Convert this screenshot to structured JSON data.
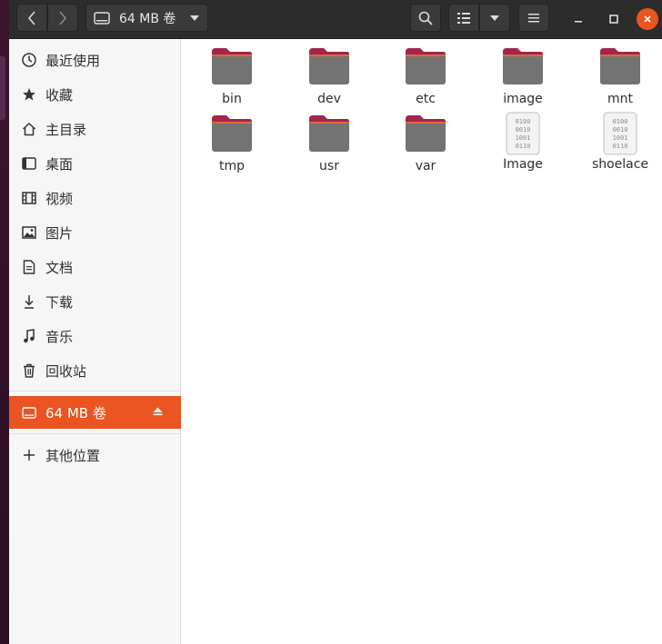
{
  "window": {
    "location_label": "64 MB 卷"
  },
  "sidebar": {
    "items": [
      {
        "label": "最近使用",
        "icon": "clock-icon"
      },
      {
        "label": "收藏",
        "icon": "star-icon"
      },
      {
        "label": "主目录",
        "icon": "home-icon"
      },
      {
        "label": "桌面",
        "icon": "desktop-icon"
      },
      {
        "label": "视频",
        "icon": "video-icon"
      },
      {
        "label": "图片",
        "icon": "picture-icon"
      },
      {
        "label": "文档",
        "icon": "document-icon"
      },
      {
        "label": "下载",
        "icon": "download-icon"
      },
      {
        "label": "音乐",
        "icon": "music-icon"
      },
      {
        "label": "回收站",
        "icon": "trash-icon"
      }
    ],
    "device": {
      "label": "64 MB 卷",
      "icon": "drive-icon",
      "selected": true
    },
    "other": {
      "label": "其他位置",
      "icon": "plus-icon"
    }
  },
  "files": [
    {
      "name": "bin",
      "type": "folder"
    },
    {
      "name": "dev",
      "type": "folder"
    },
    {
      "name": "etc",
      "type": "folder"
    },
    {
      "name": "image",
      "type": "folder"
    },
    {
      "name": "mnt",
      "type": "folder"
    },
    {
      "name": "tmp",
      "type": "folder"
    },
    {
      "name": "usr",
      "type": "folder"
    },
    {
      "name": "var",
      "type": "folder"
    },
    {
      "name": "Image",
      "type": "binary"
    },
    {
      "name": "shoelace",
      "type": "binary"
    }
  ],
  "colors": {
    "accent": "#e95420",
    "header": "#2c2c2c",
    "folder_tab": "#a2264b",
    "folder_body": "#737373"
  }
}
